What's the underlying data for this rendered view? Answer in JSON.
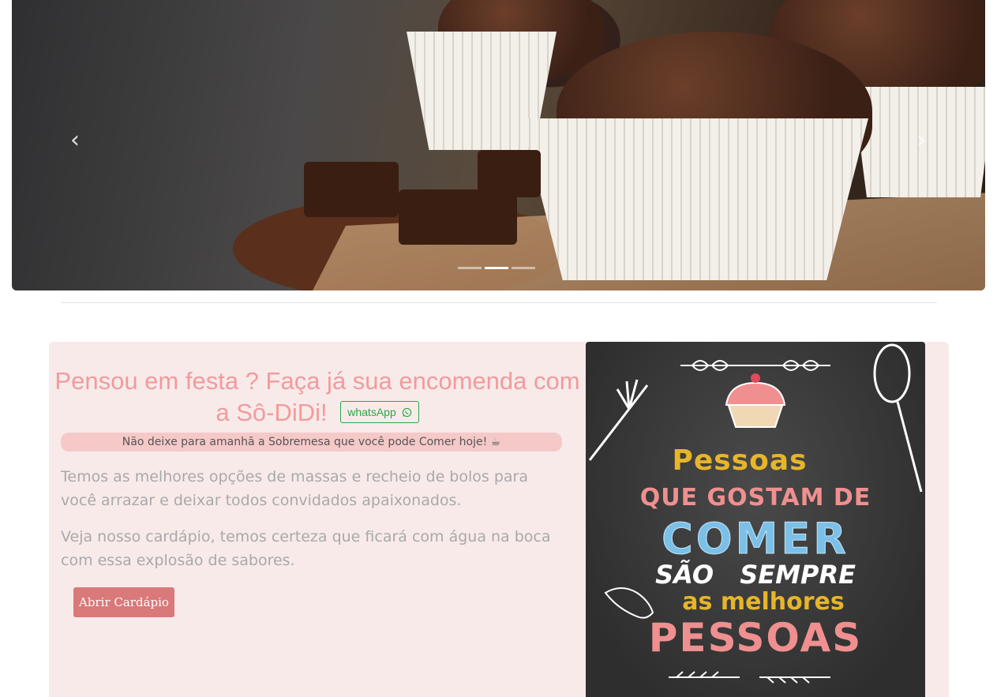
{
  "carousel": {
    "prev_icon": "chevron-left-icon",
    "next_icon": "chevron-right-icon",
    "prev_glyph": "‹",
    "next_glyph": "›",
    "slide_count": 3,
    "active_index": 1
  },
  "promo": {
    "headline": "Pensou em festa ? Faça já sua encomenda com a Sô-DiDi!",
    "whatsapp_label": "whatsApp",
    "whatsapp_icon": "whatsapp-icon",
    "tagline": "Não deixe para amanhã a Sobremesa que você pode Comer hoje! ☕",
    "paragraph1": "Temos as melhores opções de massas e recheio de bolos para você arrazar e deixar todos convidados apaixonados.",
    "paragraph2": "Veja nosso cardápio, temos certeza que ficará com água na boca com essa explosão de sabores.",
    "menu_button": "Abrir Cardápio"
  },
  "poster": {
    "line1": "Pessoas",
    "line2": "QUE GOSTAM DE",
    "line3": "COMER",
    "line4": "SÃO SEMPRE",
    "line5": "as melhores",
    "line6": "PESSOAS"
  },
  "colors": {
    "accent_pink": "#f19b9b",
    "button_pink": "#d9797a",
    "whatsapp_green": "#28a745",
    "card_bg": "#f9eaea"
  }
}
